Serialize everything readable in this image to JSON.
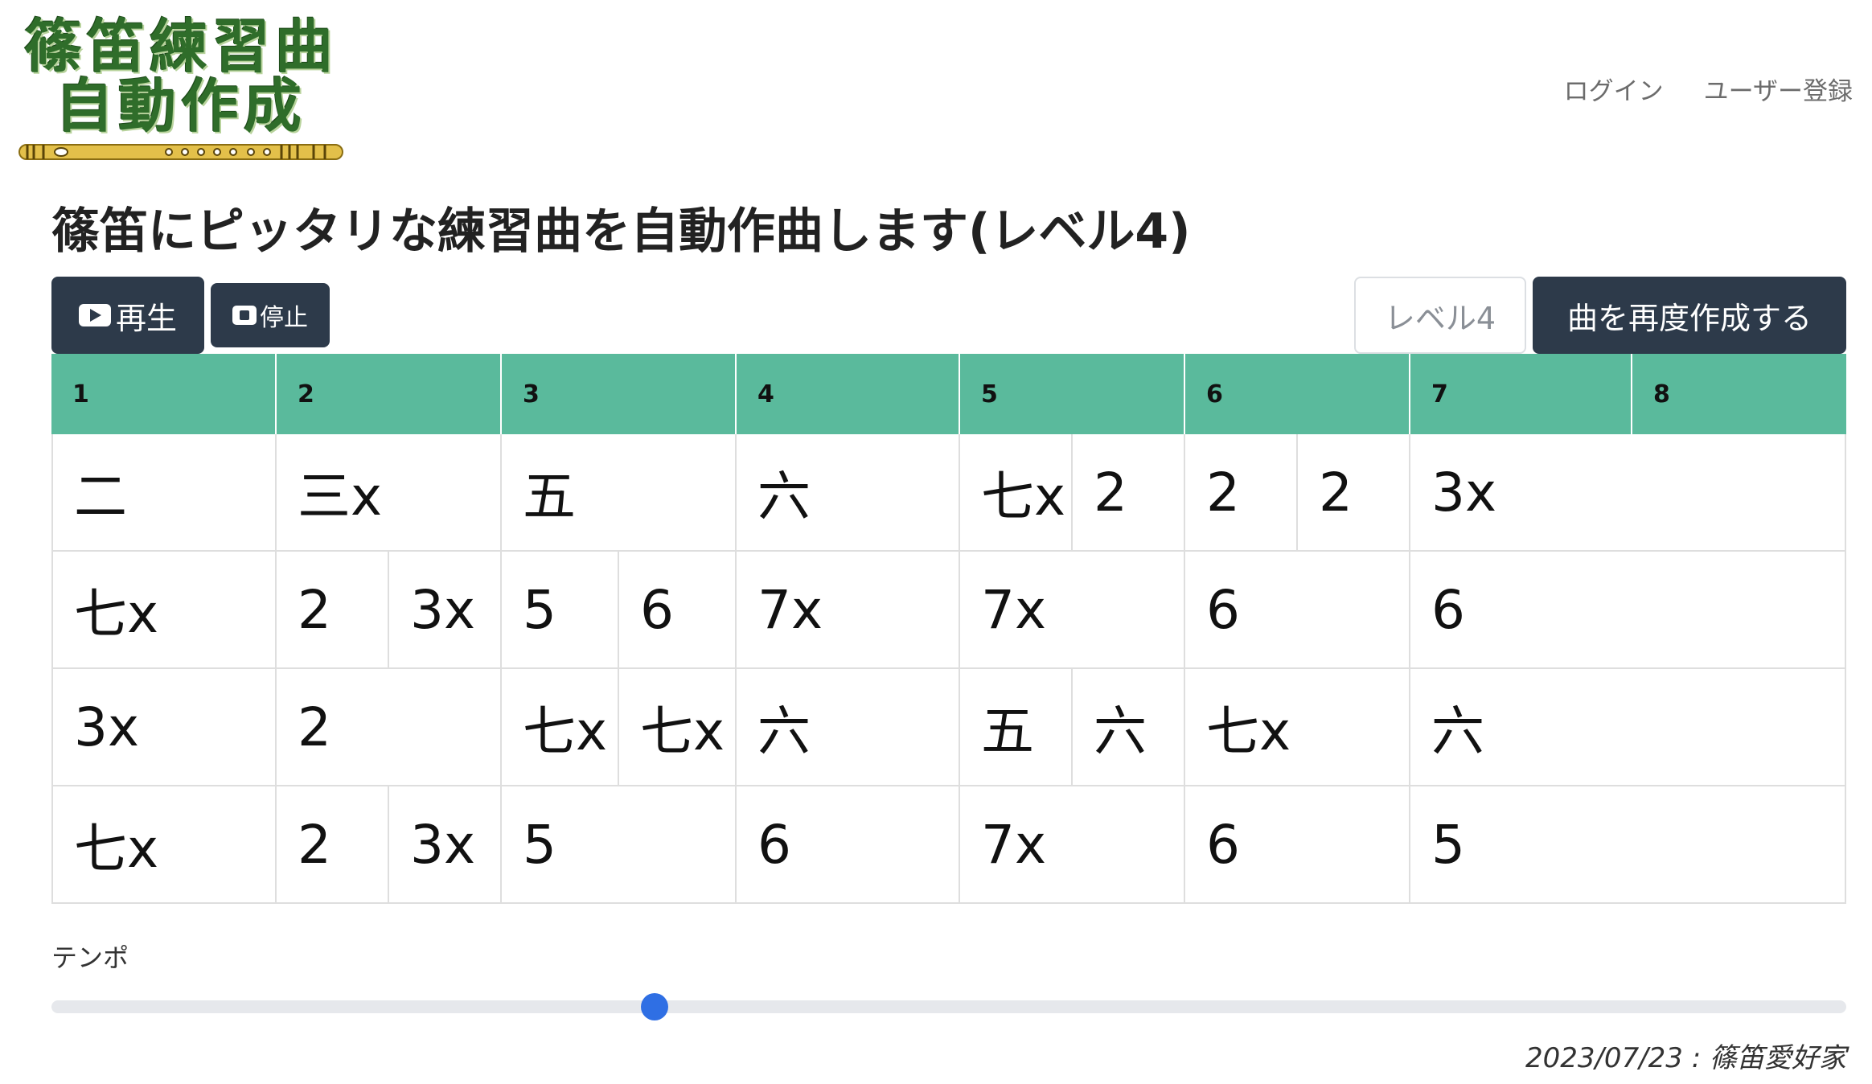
{
  "logo": {
    "line1": "篠笛練習曲",
    "line2": "自動作成"
  },
  "nav": {
    "login": "ログイン",
    "register": "ユーザー登録"
  },
  "page_title": "篠笛にピッタリな練習曲を自動作曲します(レベル4)",
  "toolbar": {
    "play_label": "再生",
    "stop_label": "停止",
    "level_label": "レベル4",
    "regenerate_label": "曲を再度作成する"
  },
  "measures": [
    "1",
    "2",
    "3",
    "4",
    "5",
    "6",
    "7",
    "8"
  ],
  "rows": [
    [
      [
        "二"
      ],
      [
        "三x"
      ],
      [
        "五"
      ],
      [
        "六"
      ],
      [
        "七x",
        "2"
      ],
      [
        "2",
        "2"
      ],
      [
        "3x"
      ],
      []
    ],
    [
      [
        "七x"
      ],
      [
        "2",
        "3x"
      ],
      [
        "5",
        "6"
      ],
      [
        "7x"
      ],
      [
        "7x"
      ],
      [
        "6"
      ],
      [
        "6"
      ],
      []
    ],
    [
      [
        "3x"
      ],
      [
        "2"
      ],
      [
        "七x",
        "七x"
      ],
      [
        "六"
      ],
      [
        "五",
        "六"
      ],
      [
        "七x"
      ],
      [
        "六"
      ],
      []
    ],
    [
      [
        "七x"
      ],
      [
        "2",
        "3x"
      ],
      [
        "5"
      ],
      [
        "6"
      ],
      [
        "7x"
      ],
      [
        "6"
      ],
      [
        "5"
      ],
      []
    ]
  ],
  "tempo": {
    "label": "テンポ",
    "value_fraction": 0.336
  },
  "footer": {
    "text": "2023/07/23 : 篠笛愛好家"
  },
  "colors": {
    "header_green": "#5aba9c",
    "button_dark": "#2d3a4a",
    "slider_thumb": "#2f6fe4",
    "logo_green": "#2f6d2a"
  }
}
